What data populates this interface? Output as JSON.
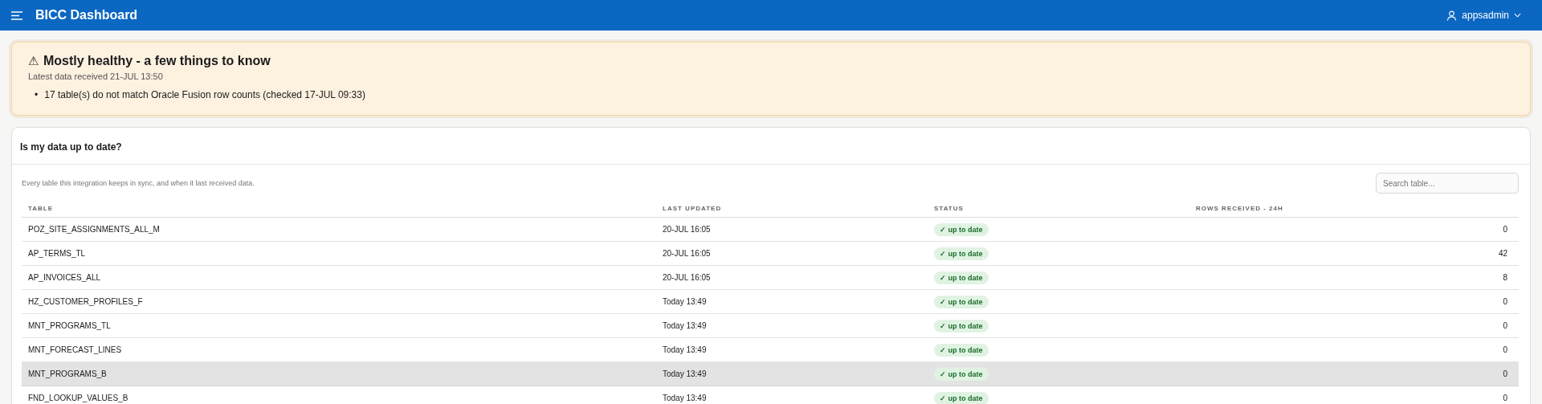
{
  "app_bar": {
    "title": "BICC Dashboard",
    "user": "appsadmin"
  },
  "alert": {
    "kind": "warning",
    "icon": "⚠",
    "bullet": "•",
    "title": "Mostly healthy - a few things to know",
    "subtitle": "Latest data received 21-JUL 13:50",
    "items": [
      "17 table(s) do not match Oracle Fusion row counts (checked 17-JUL 09:33)"
    ]
  },
  "card": {
    "title": "Is my data up to date?",
    "description": "Every table this integration keeps in sync, and when it last received data.",
    "search": {
      "placeholder": "Search table..."
    },
    "table": {
      "columns": [
        "TABLE",
        "LAST UPDATED",
        "STATUS",
        "ROWS RECEIVED - 24H"
      ],
      "rows": [
        {
          "table": "POZ_SITE_ASSIGNMENTS_ALL_M",
          "last_updated": "20-JUL 16:05",
          "status": "✓ up to date",
          "kind": "ok",
          "rows": "0",
          "selected": false
        },
        {
          "table": "AP_TERMS_TL",
          "last_updated": "20-JUL 16:05",
          "status": "✓ up to date",
          "kind": "ok",
          "rows": "42",
          "selected": false
        },
        {
          "table": "AP_INVOICES_ALL",
          "last_updated": "20-JUL 16:05",
          "status": "✓ up to date",
          "kind": "ok",
          "rows": "8",
          "selected": false
        },
        {
          "table": "HZ_CUSTOMER_PROFILES_F",
          "last_updated": "Today 13:49",
          "status": "✓ up to date",
          "kind": "ok",
          "rows": "0",
          "selected": false
        },
        {
          "table": "MNT_PROGRAMS_TL",
          "last_updated": "Today 13:49",
          "status": "✓ up to date",
          "kind": "ok",
          "rows": "0",
          "selected": false
        },
        {
          "table": "MNT_FORECAST_LINES",
          "last_updated": "Today 13:49",
          "status": "✓ up to date",
          "kind": "ok",
          "rows": "0",
          "selected": false
        },
        {
          "table": "MNT_PROGRAMS_B",
          "last_updated": "Today 13:49",
          "status": "✓ up to date",
          "kind": "ok",
          "rows": "0",
          "selected": true
        },
        {
          "table": "FND_LOOKUP_VALUES_B",
          "last_updated": "Today 13:49",
          "status": "✓ up to date",
          "kind": "ok",
          "rows": "0",
          "selected": false
        }
      ]
    }
  }
}
